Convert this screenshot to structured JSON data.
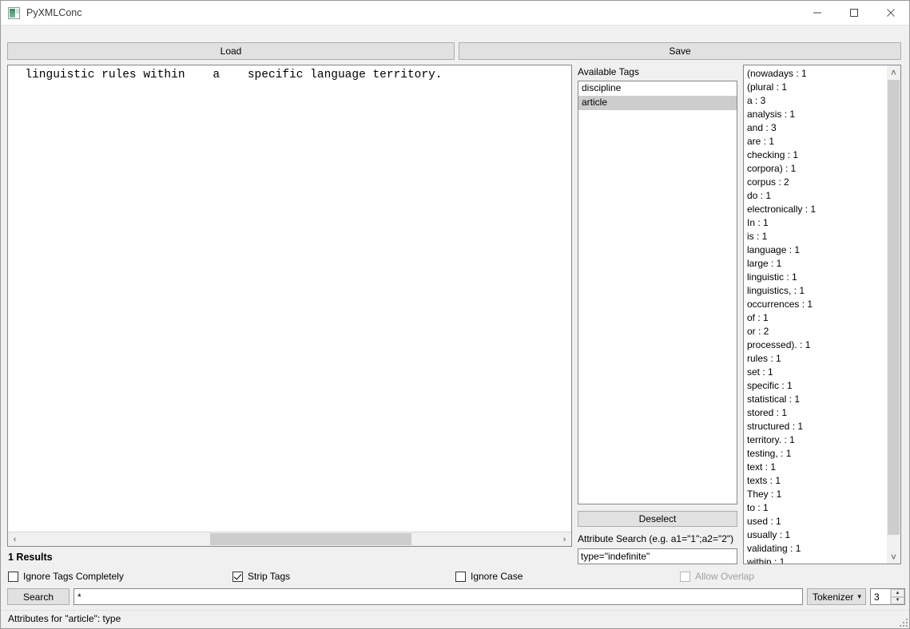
{
  "window": {
    "title": "PyXMLConc",
    "icon": "app-icon",
    "minimize_glyph": "—",
    "maximize_glyph": "□",
    "close_glyph": "✕"
  },
  "toolbar": {
    "load_label": "Load",
    "save_label": "Save"
  },
  "text_panel": {
    "content": "  linguistic rules within    a    specific language territory.",
    "hscroll_left_glyph": "‹",
    "hscroll_right_glyph": "›"
  },
  "tags": {
    "label": "Available Tags",
    "items": [
      {
        "name": "discipline",
        "selected": false
      },
      {
        "name": "article",
        "selected": true
      }
    ],
    "deselect_label": "Deselect",
    "attribute_search_label": "Attribute Search (e.g. a1=\"1\";a2=\"2\")",
    "attribute_search_value": "type=\"indefinite\"",
    "attribute_search_placeholder": ""
  },
  "frequencies": {
    "entries": [
      "(nowadays : 1",
      "(plural : 1",
      "a : 3",
      "analysis : 1",
      "and : 3",
      "are : 1",
      "checking : 1",
      "corpora) : 1",
      "corpus : 2",
      "do : 1",
      "electronically : 1",
      "In : 1",
      "is : 1",
      "language : 1",
      "large : 1",
      "linguistic : 1",
      "linguistics, : 1",
      "occurrences : 1",
      "of : 1",
      "or : 2",
      "processed). : 1",
      "rules : 1",
      "set : 1",
      "specific : 1",
      "statistical : 1",
      "stored : 1",
      "structured : 1",
      "territory. : 1",
      "testing, : 1",
      "text : 1",
      "texts : 1",
      "They : 1",
      "to : 1",
      "used : 1",
      "usually : 1",
      "validating : 1",
      "within : 1"
    ],
    "scroll_up_glyph": "˄",
    "scroll_down_glyph": "˅"
  },
  "results": {
    "label": "1 Results"
  },
  "options": {
    "ignore_tags_completely": {
      "label": "Ignore Tags Completely",
      "checked": false,
      "enabled": true
    },
    "strip_tags": {
      "label": "Strip Tags",
      "checked": true,
      "enabled": true
    },
    "ignore_case": {
      "label": "Ignore Case",
      "checked": false,
      "enabled": true
    },
    "allow_overlap": {
      "label": "Allow Overlap",
      "checked": false,
      "enabled": false
    }
  },
  "search": {
    "button_label": "Search",
    "query_value": "*",
    "query_placeholder": "",
    "tokenizer_label": "Tokenizer",
    "tokenizer_chevron": "▼",
    "context_size": "3",
    "spin_up_glyph": "▲",
    "spin_down_glyph": "▼"
  },
  "statusbar": {
    "text": "Attributes for \"article\": type"
  },
  "colors": {
    "window_bg": "#f0f0f0",
    "panel_bg": "#ffffff",
    "border": "#828790",
    "button_bg": "#e1e1e1",
    "button_border": "#adadad",
    "selection": "#cdcdcd",
    "scroll_thumb": "#cdcdcd",
    "disabled_text": "#a0a0a0"
  }
}
